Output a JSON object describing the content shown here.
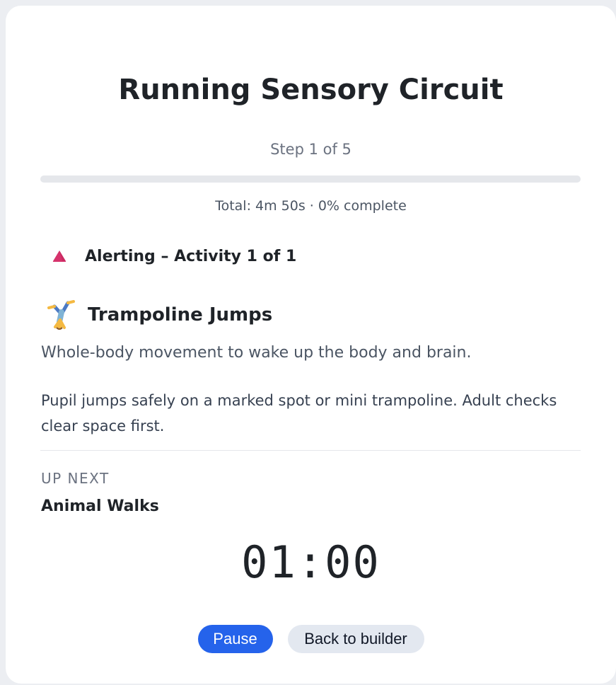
{
  "header": {
    "title": "Running Sensory Circuit",
    "step_text": "Step 1 of 5"
  },
  "progress": {
    "fraction": 0,
    "total_text": "Total: 4m 50s · 0% complete"
  },
  "zone": {
    "icon": "red-triangle-icon",
    "label": "Alerting – Activity 1 of 1",
    "color": "#d6336c"
  },
  "activity": {
    "icon": "cartwheel-person-icon",
    "name": "Trampoline Jumps",
    "summary": "Whole-body movement to wake up the body and brain.",
    "details": "Pupil jumps safely on a marked spot or mini trampoline. Adult checks clear space first."
  },
  "up_next": {
    "heading": "Up next",
    "name": "Animal Walks"
  },
  "timer": {
    "display": "01:00"
  },
  "controls": {
    "pause_label": "Pause",
    "back_label": "Back to builder"
  },
  "colors": {
    "accent": "#2563eb",
    "secondary_button": "#e3e8f0",
    "progress_track": "#e5e7eb"
  }
}
